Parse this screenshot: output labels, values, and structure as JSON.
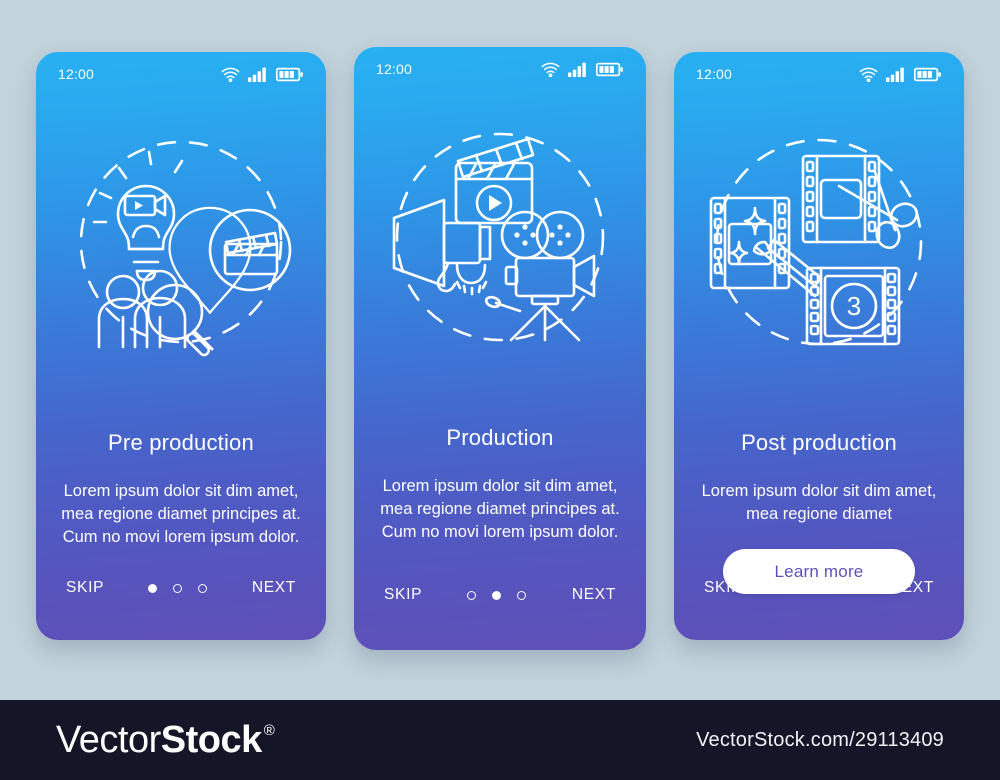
{
  "background_color": "#c3d3dc",
  "card_gradient": {
    "top": "#27b0f2",
    "bottom": "#5e50b8"
  },
  "screens": [
    {
      "status": {
        "time": "12:00",
        "wifi_icon": "wifi-icon",
        "signal_icon": "signal-bars-icon",
        "battery_icon": "battery-icon"
      },
      "illustration_name": "pre-production-illustration",
      "title": "Pre production",
      "paragraph": "Lorem ipsum dolor sit dim amet, mea regione diamet principes at. Cum no movi lorem ipsum dolor.",
      "skip_label": "SKIP",
      "next_label": "NEXT",
      "dots": [
        true,
        false,
        false
      ],
      "has_button": false,
      "button_label": ""
    },
    {
      "status": {
        "time": "12:00",
        "wifi_icon": "wifi-icon",
        "signal_icon": "signal-bars-icon",
        "battery_icon": "battery-icon"
      },
      "illustration_name": "production-illustration",
      "title": "Production",
      "paragraph": "Lorem ipsum dolor sit dim amet, mea regione diamet principes at. Cum no movi lorem ipsum dolor.",
      "skip_label": "SKIP",
      "next_label": "NEXT",
      "dots": [
        false,
        true,
        false
      ],
      "has_button": false,
      "button_label": ""
    },
    {
      "status": {
        "time": "12:00",
        "wifi_icon": "wifi-icon",
        "signal_icon": "signal-bars-icon",
        "battery_icon": "battery-icon"
      },
      "illustration_name": "post-production-illustration",
      "title": "Post production",
      "paragraph": "Lorem ipsum dolor sit dim amet, mea regione diamet",
      "skip_label": "SKIP",
      "next_label": "NEXT",
      "dots": [
        false,
        false,
        true
      ],
      "has_button": true,
      "button_label": "Learn more"
    }
  ],
  "footer": {
    "brand_light": "Vector",
    "brand_bold": "Stock",
    "brand_registered": "®",
    "url": "VectorStock.com/29113409",
    "background": "#151528"
  }
}
